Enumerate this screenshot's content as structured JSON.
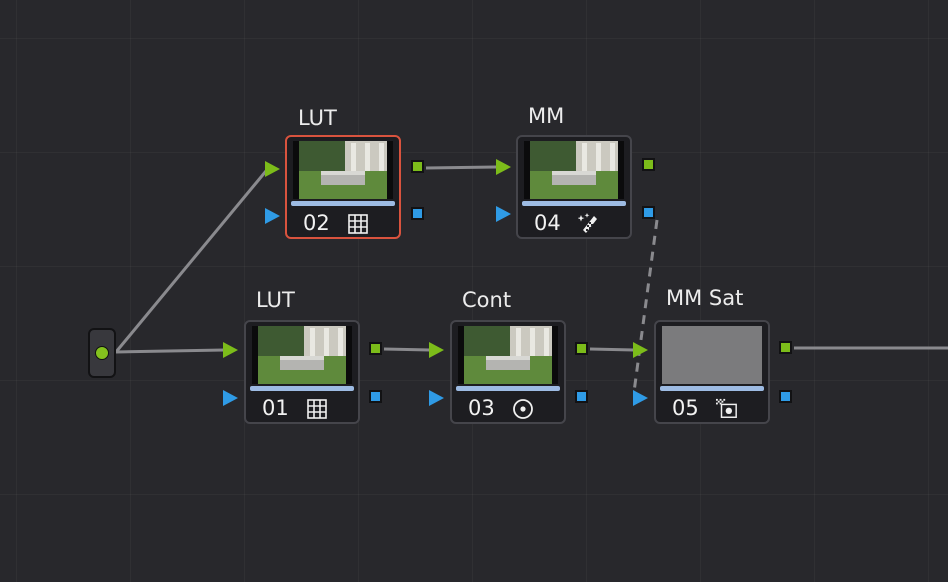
{
  "colors": {
    "background": "#28282c",
    "node_bg": "#1d1d21",
    "node_border": "#45454b",
    "selected_border": "#d9533e",
    "rgb_port": "#7cbc1a",
    "alpha_port": "#2f9be6",
    "wire": "#8a8a8e"
  },
  "nodes": [
    {
      "label": "LUT",
      "number": "02",
      "tool": "lut",
      "icon": "grid-icon",
      "selected": true,
      "thumbnail": "clip-thumbnail"
    },
    {
      "label": "MM",
      "number": "04",
      "tool": "magic-mask",
      "icon": "magic-wand-icon",
      "selected": false,
      "thumbnail": "clip-thumbnail"
    },
    {
      "label": "LUT",
      "number": "01",
      "tool": "lut",
      "icon": "grid-icon",
      "selected": false,
      "thumbnail": "clip-thumbnail"
    },
    {
      "label": "Cont",
      "number": "03",
      "tool": "contrast",
      "icon": "wheel-icon",
      "selected": false,
      "thumbnail": "clip-thumbnail"
    },
    {
      "label": "MM Sat",
      "number": "05",
      "tool": "saturation",
      "icon": "qualifier-icon",
      "selected": false,
      "thumbnail": "gray-thumbnail"
    }
  ]
}
